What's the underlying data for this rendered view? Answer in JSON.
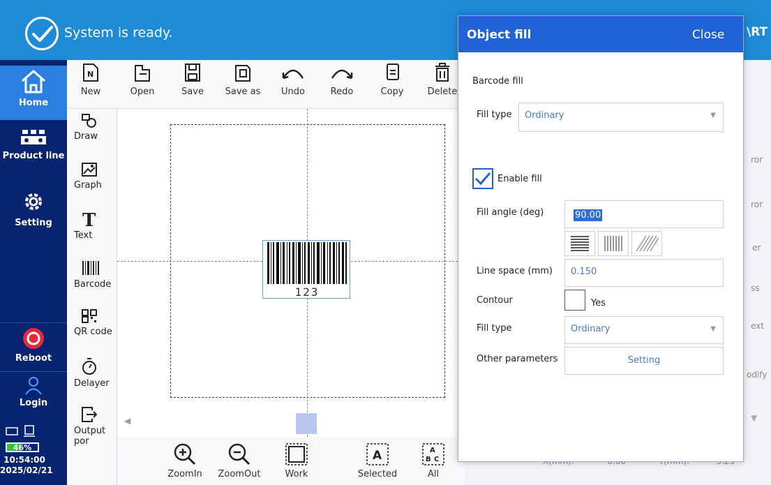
{
  "status": {
    "message": "System is ready.",
    "header_right_fragment": "\\RT"
  },
  "nav": {
    "home": "Home",
    "product_line": "Product line",
    "setting": "Setting",
    "reboot": "Reboot",
    "login": "Login",
    "battery_percent": "46%",
    "battery_level": 0.46,
    "time": "10:54:00",
    "date": "2025/02/21"
  },
  "toolbar": {
    "items": [
      "New",
      "Open",
      "Save",
      "Save as",
      "Undo",
      "Redo",
      "Copy",
      "Delete"
    ]
  },
  "tools": {
    "items": [
      "Draw",
      "Graph",
      "Text",
      "Barcode",
      "QR code",
      "Delayer",
      "Output por"
    ]
  },
  "canvas": {
    "barcode_text": "123"
  },
  "bottom": {
    "items": [
      "ZoomIn",
      "ZoomOut",
      "Work",
      "Selected",
      "All"
    ]
  },
  "background_fragments": [
    "ror",
    "ror",
    "er",
    "ss",
    "ext",
    "odify",
    "X(mm):",
    "-0.00",
    "Y(mm):",
    "-3.25"
  ],
  "dialog": {
    "title": "Object fill",
    "close": "Close",
    "section_barcode_fill": "Barcode fill",
    "fill_type_label_1": "Fill type",
    "fill_type_value_1": "Ordinary",
    "enable_fill_label": "Enable fill",
    "enable_fill_checked": true,
    "fill_angle_label": "Fill angle (deg)",
    "fill_angle_value": "90.00",
    "line_space_label": "Line space (mm)",
    "line_space_value": "0.150",
    "contour_label": "Contour",
    "contour_yes": "Yes",
    "contour_checked": false,
    "fill_type_label_2": "Fill type",
    "fill_type_value_2": "Ordinary",
    "other_params_label": "Other parameters",
    "setting_button": "Setting"
  },
  "colors": {
    "topbar": "#1f8ad6",
    "nav": "#06246f",
    "nav_active": "#2a7fe0",
    "dialog_header": "#1f63d6",
    "reboot_icon": "#e8283c",
    "battery": "#31c638"
  }
}
